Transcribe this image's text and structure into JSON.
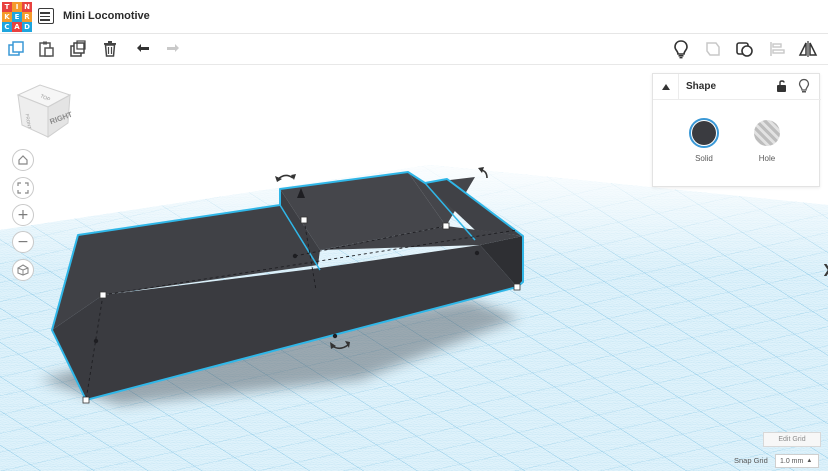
{
  "app": {
    "logo_letters": [
      "T",
      "I",
      "N",
      "K",
      "E",
      "R",
      "C",
      "A",
      "D"
    ],
    "logo_colors": [
      "#e8423f",
      "#f59a2b",
      "#e8423f",
      "#f59a2b",
      "#1fa5dd",
      "#f59a2b",
      "#1fa5dd",
      "#e8423f",
      "#1fa5dd"
    ],
    "title": "Mini Locomotive"
  },
  "toolbar": {
    "left_icons": [
      "copy-icon",
      "paste-icon",
      "duplicate-icon",
      "trash-icon",
      "undo-icon",
      "redo-icon"
    ],
    "right_icons": [
      "lightbulb-icon",
      "group-icon",
      "ungroup-icon",
      "align-icon",
      "mirror-icon"
    ]
  },
  "viewcube": {
    "face_label": "RIGHT",
    "top_label": "TOP",
    "side_label": "FRONT"
  },
  "view_controls": [
    "home-icon",
    "fit-icon",
    "zoom-in-icon",
    "zoom-out-icon",
    "perspective-icon"
  ],
  "shape_panel": {
    "title": "Shape",
    "solid_label": "Solid",
    "hole_label": "Hole",
    "selected": "Solid",
    "shape_color": "#3a3b40",
    "accent": "#3a98d6"
  },
  "workplane": {
    "edit_grid_label": "Edit Grid",
    "snap_grid_label": "Snap Grid",
    "snap_grid_value": "1.0 mm",
    "grid_color": "#bfe3f3",
    "selection_color": "#30b7e8"
  }
}
